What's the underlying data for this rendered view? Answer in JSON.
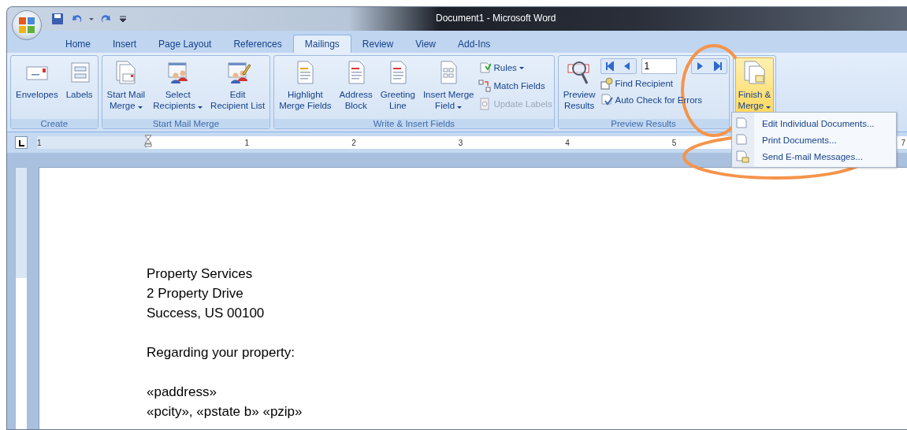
{
  "window": {
    "title": "Document1 - Microsoft Word"
  },
  "tabs": [
    {
      "label": "Home",
      "selected": false
    },
    {
      "label": "Insert",
      "selected": false
    },
    {
      "label": "Page Layout",
      "selected": false
    },
    {
      "label": "References",
      "selected": false
    },
    {
      "label": "Mailings",
      "selected": true
    },
    {
      "label": "Review",
      "selected": false
    },
    {
      "label": "View",
      "selected": false
    },
    {
      "label": "Add-Ins",
      "selected": false
    }
  ],
  "ribbon_groups": [
    {
      "label": "Create",
      "items": [
        {
          "kind": "large",
          "lines": [
            "Envelopes"
          ],
          "dropdown": false,
          "highlighted": false
        },
        {
          "kind": "large",
          "lines": [
            "Labels"
          ],
          "dropdown": false,
          "highlighted": false
        }
      ]
    },
    {
      "label": "Start Mail Merge",
      "items": [
        {
          "kind": "large",
          "lines": [
            "Start Mail",
            "Merge"
          ],
          "dropdown": true,
          "highlighted": false
        },
        {
          "kind": "large",
          "lines": [
            "Select",
            "Recipients"
          ],
          "dropdown": true,
          "highlighted": false
        },
        {
          "kind": "large",
          "lines": [
            "Edit",
            "Recipient List"
          ],
          "dropdown": false,
          "highlighted": false
        }
      ]
    },
    {
      "label": "Write & Insert Fields",
      "items": [
        {
          "kind": "large",
          "lines": [
            "Highlight",
            "Merge Fields"
          ],
          "dropdown": false,
          "highlighted": false
        },
        {
          "kind": "large",
          "lines": [
            "Address",
            "Block"
          ],
          "dropdown": false,
          "highlighted": false
        },
        {
          "kind": "large",
          "lines": [
            "Greeting",
            "Line"
          ],
          "dropdown": false,
          "highlighted": false
        },
        {
          "kind": "large",
          "lines": [
            "Insert Merge",
            "Field"
          ],
          "dropdown": true,
          "highlighted": false
        },
        {
          "kind": "small_stack",
          "rows": [
            {
              "label": "Rules",
              "dropdown": true,
              "disabled": false
            },
            {
              "label": "Match Fields",
              "dropdown": false,
              "disabled": false
            },
            {
              "label": "Update Labels",
              "dropdown": false,
              "disabled": true
            }
          ]
        }
      ]
    },
    {
      "label": "Preview Results",
      "items": [
        {
          "kind": "large",
          "lines": [
            "Preview",
            "Results"
          ],
          "dropdown": false,
          "highlighted": false
        },
        {
          "kind": "navigator",
          "record": "1",
          "rows": [
            {
              "label": "Find Recipient",
              "dropdown": false,
              "disabled": false
            },
            {
              "label": "Auto Check for Errors",
              "dropdown": false,
              "disabled": false
            }
          ]
        }
      ]
    },
    {
      "items": [
        {
          "kind": "large",
          "lines": [
            "Finish &",
            "Merge"
          ],
          "dropdown": true,
          "highlighted": true
        }
      ]
    }
  ],
  "menu": {
    "items": [
      {
        "label": "Edit Individual Documents..."
      },
      {
        "label": "Print Documents..."
      },
      {
        "label": "Send E-mail Messages..."
      }
    ]
  },
  "ruler": {
    "numbers": [
      "1",
      "1",
      "2",
      "3",
      "4",
      "5",
      "7"
    ]
  },
  "document": {
    "paragraphs": [
      [
        "Property Services",
        "2 Property Drive",
        "Success, US 00100"
      ],
      [
        "Regarding your property:"
      ],
      [
        "«paddress»",
        "«pcity», «pstate b» «pzip»"
      ]
    ]
  }
}
